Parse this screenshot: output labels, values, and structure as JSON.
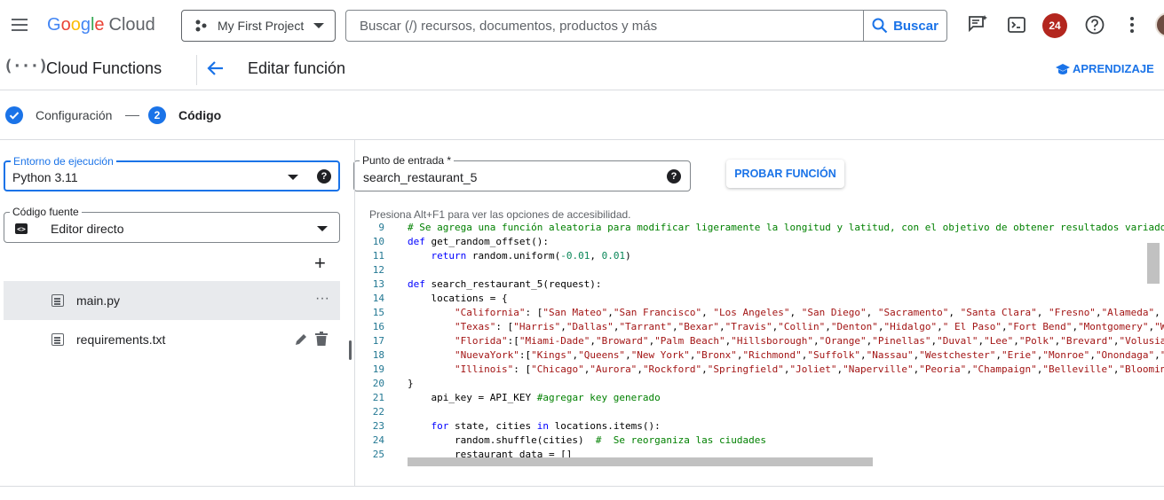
{
  "header": {
    "logo_parts": [
      "G",
      "o",
      "o",
      "g",
      "l",
      "e"
    ],
    "logo_suffix": "Cloud",
    "project": "My First Project",
    "search_placeholder": "Buscar (/) recursos, documentos, productos y más",
    "search_button": "Buscar",
    "notification_count": "24"
  },
  "product_bar": {
    "product_name": "Cloud Functions",
    "page_title": "Editar función",
    "learn_label": "APRENDIZAJE"
  },
  "stepper": {
    "step1_label": "Configuración",
    "step2_number": "2",
    "step2_label": "Código"
  },
  "form": {
    "runtime_label": "Entorno de ejecución",
    "runtime_value": "Python 3.11",
    "entry_label": "Punto de entrada *",
    "entry_value": "search_restaurant_5",
    "test_button": "PROBAR FUNCIÓN",
    "source_label": "Código fuente",
    "source_value": "Editor directo",
    "help_glyph": "?"
  },
  "files": [
    {
      "name": "main.py",
      "selected": true
    },
    {
      "name": "requirements.txt",
      "selected": false
    }
  ],
  "editor": {
    "a11y_hint": "Presiona Alt+F1 para ver las opciones de accesibilidad.",
    "lines": [
      {
        "n": "9",
        "html": "<span class=\"cm\"># Se agrega una función aleatoria para modificar ligeramente la longitud y latitud, con el objetivo de obtener resultados variados</span>"
      },
      {
        "n": "10",
        "html": "<span class=\"kw\">def</span> get_random_offset():"
      },
      {
        "n": "11",
        "html": "    <span class=\"kw\">return</span> random.uniform(<span class=\"num\">-0.01</span>, <span class=\"num\">0.01</span>)"
      },
      {
        "n": "12",
        "html": ""
      },
      {
        "n": "13",
        "html": "<span class=\"kw\">def</span> search_restaurant_5(request):"
      },
      {
        "n": "14",
        "html": "    locations = {"
      },
      {
        "n": "15",
        "html": "        <span class=\"str\">\"California\"</span>: [<span class=\"str\">\"San Mateo\"</span>,<span class=\"str\">\"San Francisco\"</span>, <span class=\"str\">\"Los Angeles\"</span>, <span class=\"str\">\"San Diego\"</span>, <span class=\"str\">\"Sacramento\"</span>, <span class=\"str\">\"Santa Clara\"</span>, <span class=\"str\">\"Fresno\"</span>,<span class=\"str\">\"Alameda\"</span>,"
      },
      {
        "n": "16",
        "html": "        <span class=\"str\">\"Texas\"</span>: [<span class=\"str\">\"Harris\"</span>,<span class=\"str\">\"Dallas\"</span>,<span class=\"str\">\"Tarrant\"</span>,<span class=\"str\">\"Bexar\"</span>,<span class=\"str\">\"Travis\"</span>,<span class=\"str\">\"Collin\"</span>,<span class=\"str\">\"Denton\"</span>,<span class=\"str\">\"Hidalgo\"</span>,<span class=\"str\">\" El Paso\"</span>,<span class=\"str\">\"Fort Bend\"</span>,<span class=\"str\">\"Montgomery\"</span>,<span class=\"str\">\"W</span>"
      },
      {
        "n": "17",
        "html": "        <span class=\"str\">\"Florida\"</span>:[<span class=\"str\">\"Miami-Dade\"</span>,<span class=\"str\">\"Broward\"</span>,<span class=\"str\">\"Palm Beach\"</span>,<span class=\"str\">\"Hillsborough\"</span>,<span class=\"str\">\"Orange\"</span>,<span class=\"str\">\"Pinellas\"</span>,<span class=\"str\">\"Duval\"</span>,<span class=\"str\">\"Lee\"</span>,<span class=\"str\">\"Polk\"</span>,<span class=\"str\">\"Brevard\"</span>,<span class=\"str\">\"Volusia</span>"
      },
      {
        "n": "18",
        "html": "        <span class=\"str\">\"NuevaYork\"</span>:[<span class=\"str\">\"Kings\"</span>,<span class=\"str\">\"Queens\"</span>,<span class=\"str\">\"New York\"</span>,<span class=\"str\">\"Bronx\"</span>,<span class=\"str\">\"Richmond\"</span>,<span class=\"str\">\"Suffolk\"</span>,<span class=\"str\">\"Nassau\"</span>,<span class=\"str\">\"Westchester\"</span>,<span class=\"str\">\"Erie\"</span>,<span class=\"str\">\"Monroe\"</span>,<span class=\"str\">\"Onondaga\"</span>,<span class=\"str\">\"</span>"
      },
      {
        "n": "19",
        "html": "        <span class=\"str\">\"Illinois\"</span>: [<span class=\"str\">\"Chicago\"</span>,<span class=\"str\">\"Aurora\"</span>,<span class=\"str\">\"Rockford\"</span>,<span class=\"str\">\"Springfield\"</span>,<span class=\"str\">\"Joliet\"</span>,<span class=\"str\">\"Naperville\"</span>,<span class=\"str\">\"Peoria\"</span>,<span class=\"str\">\"Champaign\"</span>,<span class=\"str\">\"Belleville\"</span>,<span class=\"str\">\"Bloomin</span>"
      },
      {
        "n": "20",
        "html": "}"
      },
      {
        "n": "21",
        "html": "    api_key = API_KEY <span class=\"cm\">#agregar key generado</span>"
      },
      {
        "n": "22",
        "html": ""
      },
      {
        "n": "23",
        "html": "    <span class=\"kw\">for</span> state, cities <span class=\"kw\">in</span> locations.items():"
      },
      {
        "n": "24",
        "html": "        random.shuffle(cities)  <span class=\"cm\">#  Se reorganiza las ciudades</span>"
      },
      {
        "n": "25",
        "html": "        restaurant_data = []"
      }
    ]
  },
  "colors": {
    "accent": "#1a73e8",
    "avatar": "#b3261e"
  },
  "icons": [
    "menu-icon",
    "project-icon",
    "search-icon",
    "gemini-icon",
    "cloud-shell-icon",
    "help-icon",
    "more-vert-icon",
    "cloud-functions-icon",
    "arrow-back-icon",
    "school-icon",
    "check-circle-icon",
    "code-icon",
    "add-icon",
    "file-icon",
    "edit-icon",
    "delete-icon"
  ]
}
